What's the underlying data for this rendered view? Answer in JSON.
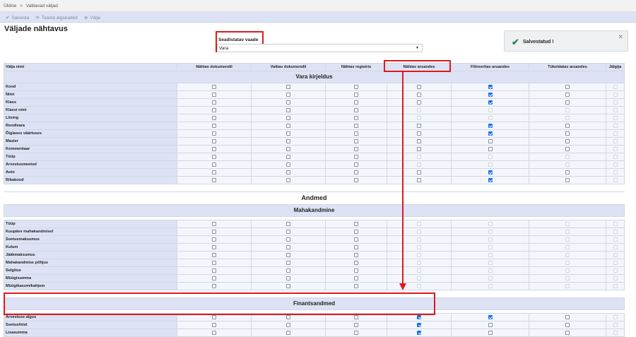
{
  "breadcrumb": {
    "home": "Üldine",
    "sep": ">",
    "current": "Valitavad väljad"
  },
  "toolbar": {
    "save_label": "Salvesta",
    "reset_label": "Taasta algseaded",
    "close_label": "Välja"
  },
  "page": {
    "title": "Väljade nähtavus"
  },
  "view": {
    "label": "Seadistatav vaade",
    "value": "Vara"
  },
  "toast": {
    "message": "Salvestatud !"
  },
  "columns": [
    "Välja nimi",
    "Nähtav dokumendil",
    "Valitav dokumendil",
    "Nähtav registris",
    "Nähtav aruandes",
    "Filtreeritav aruandes",
    "Tükeldatav aruandes",
    "Jälgija"
  ],
  "sections": {
    "vara": "Vara kirjeldus",
    "andmed": "Andmed",
    "mahakandmine": "Mahakandmine",
    "finantsandmed": "Finantsandmed"
  },
  "rows": {
    "vara": [
      {
        "name": "Kood",
        "cb": [
          0,
          0,
          0,
          0,
          1,
          0,
          2
        ]
      },
      {
        "name": "Nimi",
        "cb": [
          0,
          0,
          0,
          0,
          1,
          0,
          2
        ]
      },
      {
        "name": "Klass",
        "cb": [
          0,
          0,
          0,
          0,
          1,
          0,
          2
        ]
      },
      {
        "name": "Klassi nimi",
        "cb": [
          0,
          0,
          0,
          2,
          2,
          2,
          2
        ]
      },
      {
        "name": "Liising",
        "cb": [
          0,
          0,
          0,
          2,
          2,
          2,
          2
        ]
      },
      {
        "name": "Rendivara",
        "cb": [
          0,
          0,
          0,
          0,
          1,
          0,
          2
        ]
      },
      {
        "name": "Õiglases väärtuses",
        "cb": [
          0,
          0,
          0,
          0,
          1,
          0,
          2
        ]
      },
      {
        "name": "Master",
        "cb": [
          0,
          0,
          0,
          0,
          0,
          0,
          2
        ]
      },
      {
        "name": "Kommentaar",
        "cb": [
          0,
          0,
          0,
          0,
          0,
          0,
          2
        ]
      },
      {
        "name": "Tüüp",
        "cb": [
          0,
          0,
          0,
          2,
          2,
          2,
          2
        ]
      },
      {
        "name": "Arvestusmeetod",
        "cb": [
          0,
          0,
          0,
          2,
          2,
          2,
          2
        ]
      },
      {
        "name": "Auto",
        "cb": [
          0,
          0,
          0,
          0,
          1,
          0,
          2
        ]
      },
      {
        "name": "Ribakood",
        "cb": [
          0,
          0,
          0,
          0,
          1,
          0,
          2
        ]
      }
    ],
    "mahakandmine": [
      {
        "name": "Tüüp",
        "cb": [
          0,
          0,
          0,
          2,
          2,
          2,
          2
        ]
      },
      {
        "name": "Kuupäev mahakandmisel",
        "cb": [
          0,
          0,
          0,
          2,
          2,
          2,
          2
        ]
      },
      {
        "name": "Soetusmaksumus",
        "cb": [
          0,
          0,
          0,
          2,
          2,
          2,
          2
        ]
      },
      {
        "name": "Kulum",
        "cb": [
          0,
          0,
          0,
          2,
          2,
          2,
          2
        ]
      },
      {
        "name": "Jääkmaksumus",
        "cb": [
          0,
          0,
          0,
          2,
          2,
          2,
          2
        ]
      },
      {
        "name": "Mahakandmise põhjus",
        "cb": [
          0,
          0,
          0,
          2,
          2,
          2,
          2
        ]
      },
      {
        "name": "Selgitus",
        "cb": [
          0,
          0,
          0,
          2,
          2,
          2,
          2
        ]
      },
      {
        "name": "Müügisumma",
        "cb": [
          0,
          0,
          0,
          2,
          2,
          2,
          2
        ]
      },
      {
        "name": "Müügikasum/kahjum",
        "cb": [
          0,
          0,
          0,
          2,
          2,
          2,
          2
        ]
      }
    ],
    "finantsandmed": [
      {
        "name": "Arvestuse algus",
        "cb": [
          0,
          0,
          0,
          1,
          1,
          0,
          2
        ]
      },
      {
        "name": "Soetushind",
        "cb": [
          0,
          0,
          0,
          1,
          0,
          0,
          2
        ]
      },
      {
        "name": "Lisasumma",
        "cb": [
          0,
          0,
          0,
          1,
          0,
          0,
          2
        ]
      }
    ]
  }
}
